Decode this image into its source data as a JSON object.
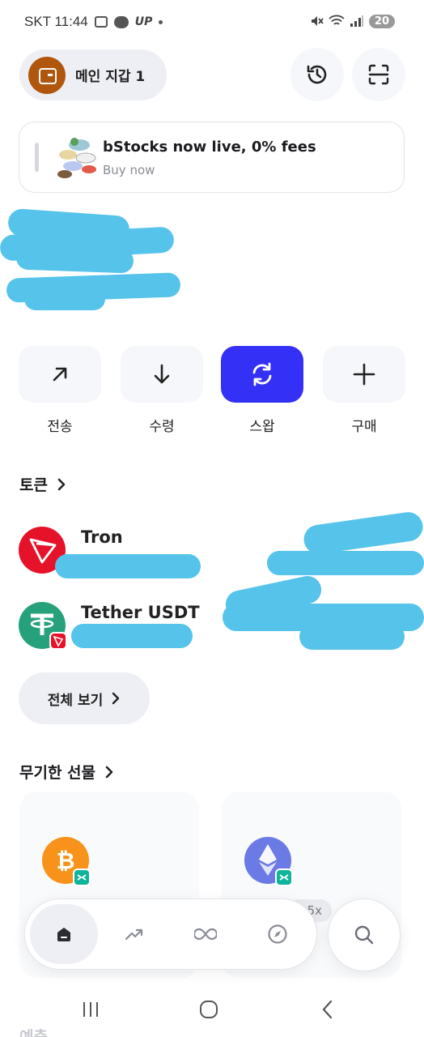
{
  "status_bar": {
    "carrier_time": "SKT 11:44",
    "up_label": "UP",
    "battery": "20"
  },
  "wallet": {
    "name": "메인 지갑 1",
    "avatar_color": "#b0560d"
  },
  "header_icons": [
    "history-icon",
    "scan-icon"
  ],
  "banner": {
    "title": "bStocks now live, 0% fees",
    "subtitle": "Buy now"
  },
  "actions": [
    {
      "label": "전송",
      "icon": "arrow-up-right-icon"
    },
    {
      "label": "수령",
      "icon": "arrow-down-icon"
    },
    {
      "label": "스왑",
      "icon": "swap-icon",
      "active": true
    },
    {
      "label": "구매",
      "icon": "plus-icon"
    }
  ],
  "tokens_section": {
    "title": "토큰",
    "items": [
      {
        "name": "Tron",
        "color": "#e5122a"
      },
      {
        "name": "Tether USDT",
        "color": "#26a17b",
        "network_badge_color": "#e5122a"
      }
    ],
    "view_all_label": "전체 보기"
  },
  "futures_section": {
    "title": "무기한 선물",
    "cards": [
      {
        "asset_icon": "bitcoin-icon",
        "color": "#f7931a"
      },
      {
        "asset_icon": "ethereum-icon",
        "color": "#6b7ae5"
      }
    ],
    "leverage_tag": "5x"
  },
  "bottom_nav": {
    "items": [
      "home-icon",
      "trending-icon",
      "infinity-icon",
      "compass-icon"
    ],
    "active": 0,
    "search_icon": "search-icon"
  },
  "peek_section": {
    "title": "예측"
  },
  "colors": {
    "accent": "#3530f5",
    "redaction": "#55c3ea"
  }
}
